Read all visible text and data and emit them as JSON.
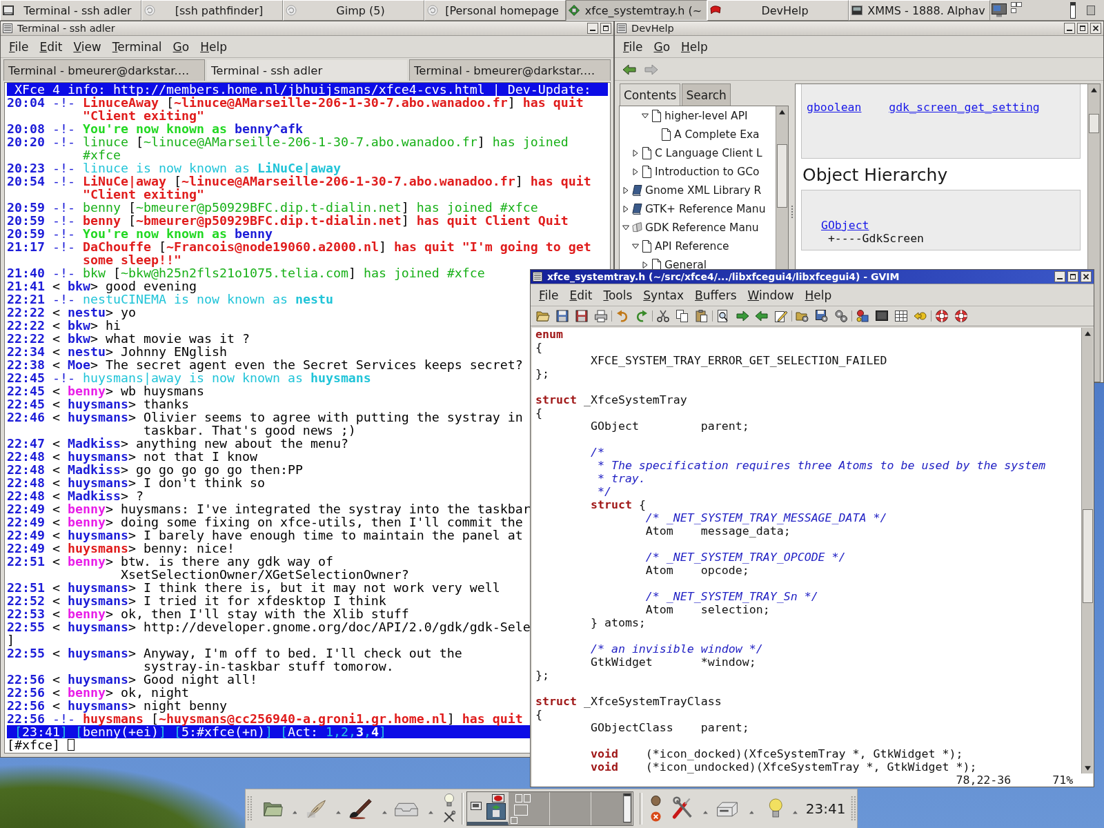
{
  "taskbar": {
    "tasks": [
      {
        "label": "Terminal - ssh adler",
        "selected": false
      },
      {
        "label": "[ssh pathfinder]",
        "selected": false
      },
      {
        "label": "Gimp (5)",
        "selected": false
      },
      {
        "label": "[Personal homepage",
        "selected": false
      },
      {
        "label": "xfce_systemtray.h (~",
        "selected": true
      },
      {
        "label": "DevHelp",
        "selected": false
      },
      {
        "label": "XMMS - 1888. Alphav",
        "selected": false
      }
    ]
  },
  "terminal_window": {
    "title": "Terminal - ssh adler",
    "active": false,
    "menu": [
      "File",
      "Edit",
      "View",
      "Terminal",
      "Go",
      "Help"
    ],
    "tabs": [
      {
        "label": "Terminal - bmeurer@darkstar.…",
        "selected": false
      },
      {
        "label": "Terminal - ssh adler",
        "selected": true
      },
      {
        "label": "Terminal - bmeurer@darkstar.…",
        "selected": false
      }
    ],
    "topic": "XFce 4 info: http://members.home.nl/jbhuijsmans/xfce4-cvs.html | Dev-Update:",
    "lines": [
      {
        "kind": "event",
        "time": "20:04",
        "marker": "-!-",
        "segments": [
          {
            "text": "LinuceAway",
            "color": "#e01c1c",
            "bold": true
          },
          {
            "text": " [",
            "color": "#000000",
            "bold": false
          },
          {
            "text": "~linuce@AMarseille-206-1-30-7.abo.wanadoo.fr",
            "color": "#e01c1c",
            "bold": true
          },
          {
            "text": "] ",
            "color": "#000000",
            "bold": false
          },
          {
            "text": "has quit",
            "color": "#e01c1c",
            "bold": true
          }
        ]
      },
      {
        "kind": "wrap",
        "segments": [
          {
            "text": "\"Client exiting\"",
            "color": "#e01c1c",
            "bold": true
          }
        ]
      },
      {
        "kind": "event",
        "time": "20:08",
        "marker": "-!-",
        "segments": [
          {
            "text": "You're now known as ",
            "color": "#22d822",
            "bold": true
          },
          {
            "text": "benny^afk",
            "color": "#1c1cd8",
            "bold": true
          }
        ]
      },
      {
        "kind": "event",
        "time": "20:20",
        "marker": "-!-",
        "segments": [
          {
            "text": "linuce",
            "color": "#18b018",
            "bold": false
          },
          {
            "text": " [",
            "color": "#000000",
            "bold": false
          },
          {
            "text": "~linuce@AMarseille-206-1-30-7.abo.wanadoo.fr",
            "color": "#18b018",
            "bold": false
          },
          {
            "text": "] ",
            "color": "#000000",
            "bold": false
          },
          {
            "text": "has joined",
            "color": "#18b018",
            "bold": false
          }
        ]
      },
      {
        "kind": "wrap",
        "segments": [
          {
            "text": "#xfce",
            "color": "#18b018",
            "bold": false
          }
        ]
      },
      {
        "kind": "event",
        "time": "20:23",
        "marker": "-!-",
        "segments": [
          {
            "text": "linuce is now known as ",
            "color": "#20c4d8",
            "bold": false
          },
          {
            "text": "LiNuCe|away",
            "color": "#20c4d8",
            "bold": true
          }
        ]
      },
      {
        "kind": "event",
        "time": "20:54",
        "marker": "-!-",
        "segments": [
          {
            "text": "LiNuCe|away",
            "color": "#e01c1c",
            "bold": true
          },
          {
            "text": " [",
            "color": "#000000",
            "bold": false
          },
          {
            "text": "~linuce@AMarseille-206-1-30-7.abo.wanadoo.fr",
            "color": "#e01c1c",
            "bold": true
          },
          {
            "text": "] ",
            "color": "#000000",
            "bold": false
          },
          {
            "text": "has quit",
            "color": "#e01c1c",
            "bold": true
          }
        ]
      },
      {
        "kind": "wrap",
        "segments": [
          {
            "text": "\"Client exiting\"",
            "color": "#e01c1c",
            "bold": true
          }
        ]
      },
      {
        "kind": "event",
        "time": "20:59",
        "marker": "-!-",
        "segments": [
          {
            "text": "benny",
            "color": "#18b018",
            "bold": false
          },
          {
            "text": " [",
            "color": "#000000",
            "bold": false
          },
          {
            "text": "~bmeurer@p50929BFC.dip.t-dialin.net",
            "color": "#18b018",
            "bold": false
          },
          {
            "text": "] ",
            "color": "#000000",
            "bold": false
          },
          {
            "text": "has joined #xfce",
            "color": "#18b018",
            "bold": false
          }
        ]
      },
      {
        "kind": "event",
        "time": "20:59",
        "marker": "-!-",
        "segments": [
          {
            "text": "benny",
            "color": "#e01c1c",
            "bold": true
          },
          {
            "text": " [",
            "color": "#000000",
            "bold": false
          },
          {
            "text": "~bmeurer@p50929BFC.dip.t-dialin.net",
            "color": "#e01c1c",
            "bold": true
          },
          {
            "text": "] ",
            "color": "#000000",
            "bold": false
          },
          {
            "text": "has quit Client Quit",
            "color": "#e01c1c",
            "bold": true
          }
        ]
      },
      {
        "kind": "event",
        "time": "20:59",
        "marker": "-!-",
        "segments": [
          {
            "text": "You're now known as ",
            "color": "#22d822",
            "bold": true
          },
          {
            "text": "benny",
            "color": "#1c1cd8",
            "bold": true
          }
        ]
      },
      {
        "kind": "event",
        "time": "21:17",
        "marker": "-!-",
        "segments": [
          {
            "text": "DaChouffe",
            "color": "#e01c1c",
            "bold": true
          },
          {
            "text": " [",
            "color": "#000000",
            "bold": false
          },
          {
            "text": "~Francois@node19060.a2000.nl",
            "color": "#e01c1c",
            "bold": true
          },
          {
            "text": "] ",
            "color": "#000000",
            "bold": false
          },
          {
            "text": "has quit \"I'm going to get",
            "color": "#e01c1c",
            "bold": true
          }
        ]
      },
      {
        "kind": "wrap",
        "segments": [
          {
            "text": "some sleep!!\"",
            "color": "#e01c1c",
            "bold": true
          }
        ]
      },
      {
        "kind": "event",
        "time": "21:40",
        "marker": "-!-",
        "segments": [
          {
            "text": "bkw",
            "color": "#18b018",
            "bold": false
          },
          {
            "text": " [",
            "color": "#000000",
            "bold": false
          },
          {
            "text": "~bkw@h25n2fls21o1075.telia.com",
            "color": "#18b018",
            "bold": false
          },
          {
            "text": "] ",
            "color": "#000000",
            "bold": false
          },
          {
            "text": "has joined #xfce",
            "color": "#18b018",
            "bold": false
          }
        ]
      },
      {
        "kind": "msg",
        "time": "21:41",
        "open": "<",
        "nick": "bkw",
        "close": ">",
        "color": "#1c1cd8",
        "text": "good evening"
      },
      {
        "kind": "event",
        "time": "22:21",
        "marker": "-!-",
        "segments": [
          {
            "text": "nestuCINEMA is now known as ",
            "color": "#20c4d8",
            "bold": false
          },
          {
            "text": "nestu",
            "color": "#20c4d8",
            "bold": true
          }
        ]
      },
      {
        "kind": "msg",
        "time": "22:22",
        "open": "<",
        "nick": "nestu",
        "close": ">",
        "color": "#1c1cd8",
        "text": "yo"
      },
      {
        "kind": "msg",
        "time": "22:22",
        "open": "<",
        "nick": "bkw",
        "close": ">",
        "color": "#1c1cd8",
        "text": "hi"
      },
      {
        "kind": "msg",
        "time": "22:22",
        "open": "<",
        "nick": "bkw",
        "close": ">",
        "color": "#1c1cd8",
        "text": "what movie was it ?"
      },
      {
        "kind": "msg",
        "time": "22:34",
        "open": "<",
        "nick": "nestu",
        "close": ">",
        "color": "#1c1cd8",
        "text": "Johnny ENglish"
      },
      {
        "kind": "msg",
        "time": "22:38",
        "open": "<",
        "nick": "Moe",
        "close": ">",
        "color": "#1c1cd8",
        "text": "The secret agent even the Secret Services keeps secret?"
      },
      {
        "kind": "event",
        "time": "22:45",
        "marker": "-!-",
        "segments": [
          {
            "text": "huysmans|away is now known as ",
            "color": "#20c4d8",
            "bold": false
          },
          {
            "text": "huysmans",
            "color": "#20c4d8",
            "bold": true
          }
        ]
      },
      {
        "kind": "msg",
        "time": "22:45",
        "open": "<",
        "nick": "benny",
        "close": ">",
        "color": "#e81ce8",
        "text": "wb huysmans"
      },
      {
        "kind": "msg",
        "time": "22:45",
        "open": "<",
        "nick": "huysmans",
        "close": ">",
        "color": "#1c1cd8",
        "text": "thanks"
      },
      {
        "kind": "msg",
        "time": "22:46",
        "open": "<",
        "nick": "huysmans",
        "close": ">",
        "color": "#1c1cd8",
        "text": "Olivier seems to agree with putting the systray in"
      },
      {
        "kind": "wrap",
        "segments": [
          {
            "text": "taskbar. That's good news ;)",
            "color": "#000000",
            "bold": false
          }
        ]
      },
      {
        "kind": "msg",
        "time": "22:47",
        "open": "<",
        "nick": "Madkiss",
        "close": ">",
        "color": "#1c1cd8",
        "text": "anything new about the menu?"
      },
      {
        "kind": "msg",
        "time": "22:48",
        "open": "<",
        "nick": "huysmans",
        "close": ">",
        "color": "#1c1cd8",
        "text": "not that I know"
      },
      {
        "kind": "msg",
        "time": "22:48",
        "open": "<",
        "nick": "Madkiss",
        "close": ">",
        "color": "#1c1cd8",
        "text": "go go go go go then:PP"
      },
      {
        "kind": "msg",
        "time": "22:48",
        "open": "<",
        "nick": "huysmans",
        "close": ">",
        "color": "#1c1cd8",
        "text": "I don't think so"
      },
      {
        "kind": "msg",
        "time": "22:48",
        "open": "<",
        "nick": "Madkiss",
        "close": ">",
        "color": "#1c1cd8",
        "text": "?"
      },
      {
        "kind": "msg",
        "time": "22:49",
        "open": "<",
        "nick": "benny",
        "close": ">",
        "color": "#e81ce8",
        "text": "huysmans: I've integrated the systray into the taskbar"
      },
      {
        "kind": "msg",
        "time": "22:49",
        "open": "<",
        "nick": "benny",
        "close": ">",
        "color": "#e81ce8",
        "text": "doing some fixing on xfce-utils, then I'll commit the"
      },
      {
        "kind": "msg",
        "time": "22:49",
        "open": "<",
        "nick": "huysmans",
        "close": ">",
        "color": "#1c1cd8",
        "text": "I barely have enough time to maintain the panel at"
      },
      {
        "kind": "msg",
        "time": "22:49",
        "open": "<",
        "nick": "huysmans",
        "close": ">",
        "color": "#e01c1c",
        "text": "benny: nice!"
      },
      {
        "kind": "msg",
        "time": "22:51",
        "open": "<",
        "nick": "benny",
        "close": ">",
        "color": "#e81ce8",
        "text": "btw. is there any gdk way of"
      },
      {
        "kind": "wrap",
        "segments": [
          {
            "text": "XsetSelectionOwner/XGetSelectionOwner?",
            "color": "#000000",
            "bold": false
          }
        ]
      },
      {
        "kind": "msg",
        "time": "22:51",
        "open": "<",
        "nick": "huysmans",
        "close": ">",
        "color": "#1c1cd8",
        "text": "I think there is, but it may not work very well"
      },
      {
        "kind": "msg",
        "time": "22:52",
        "open": "<",
        "nick": "huysmans",
        "close": ">",
        "color": "#1c1cd8",
        "text": "I tried it for xfdesktop I think"
      },
      {
        "kind": "msg",
        "time": "22:53",
        "open": "<",
        "nick": "benny",
        "close": ">",
        "color": "#e81ce8",
        "text": "ok, then I'll stay with the Xlib stuff"
      },
      {
        "kind": "msg",
        "time": "22:55",
        "open": "<",
        "nick": "huysmans",
        "close": ">",
        "color": "#1c1cd8",
        "text": "http://developer.gnome.org/doc/API/2.0/gdk/gdk-Sele"
      },
      {
        "kind": "plain",
        "text": "]"
      },
      {
        "kind": "msg",
        "time": "22:55",
        "open": "<",
        "nick": "huysmans",
        "close": ">",
        "color": "#1c1cd8",
        "text": "Anyway, I'm off to bed. I'll check out the"
      },
      {
        "kind": "wrap",
        "segments": [
          {
            "text": "systray-in-taskbar stuff tomorow.",
            "color": "#000000",
            "bold": false
          }
        ]
      },
      {
        "kind": "msg",
        "time": "22:56",
        "open": "<",
        "nick": "huysmans",
        "close": ">",
        "color": "#1c1cd8",
        "text": "Good night all!"
      },
      {
        "kind": "msg",
        "time": "22:56",
        "open": "<",
        "nick": "benny",
        "close": ">",
        "color": "#e81ce8",
        "text": "ok, night"
      },
      {
        "kind": "msg",
        "time": "22:56",
        "open": "<",
        "nick": "huysmans",
        "close": ">",
        "color": "#1c1cd8",
        "text": "night benny"
      },
      {
        "kind": "event",
        "time": "22:56",
        "marker": "-!-",
        "segments": [
          {
            "text": "huysmans",
            "color": "#e01c1c",
            "bold": true
          },
          {
            "text": " [",
            "color": "#000000",
            "bold": false
          },
          {
            "text": "~huysmans@cc256940-a.groni1.gr.home.nl",
            "color": "#e01c1c",
            "bold": true
          },
          {
            "text": "] ",
            "color": "#000000",
            "bold": false
          },
          {
            "text": "has quit",
            "color": "#e01c1c",
            "bold": true
          }
        ]
      }
    ],
    "status_bar": {
      "segments": [
        {
          "text": "[",
          "kind": "accent",
          "bold": false
        },
        {
          "text": "23:41",
          "kind": "plain",
          "bold": false
        },
        {
          "text": "] [",
          "kind": "accent",
          "bold": false
        },
        {
          "text": "benny(+ei)",
          "kind": "plain",
          "bold": false
        },
        {
          "text": "] [",
          "kind": "accent",
          "bold": false
        },
        {
          "text": "5:#xfce(+n)",
          "kind": "plain",
          "bold": false
        },
        {
          "text": "] [",
          "kind": "accent",
          "bold": false
        },
        {
          "text": "Act: ",
          "kind": "plain",
          "bold": false
        },
        {
          "text": "1,2,",
          "kind": "accent",
          "bold": false
        },
        {
          "text": "3",
          "kind": "plain",
          "bold": true
        },
        {
          "text": ",",
          "kind": "accent",
          "bold": false
        },
        {
          "text": "4",
          "kind": "plain",
          "bold": true
        },
        {
          "text": "]",
          "kind": "accent",
          "bold": false
        }
      ]
    },
    "input": {
      "prompt": "[#xfce]"
    }
  },
  "devhelp_window": {
    "title": "DevHelp",
    "active": false,
    "menu": [
      "File",
      "Go",
      "Help"
    ],
    "back_button": {
      "disabled": false
    },
    "forward_button": {
      "disabled": true
    },
    "sidebar_tabs": [
      {
        "label": "Contents",
        "selected": true
      },
      {
        "label": "Search",
        "selected": false
      }
    ],
    "tree": [
      {
        "children": [
          {
            "children": [
              {
                "label": "higher-level API",
                "kind": "page",
                "expanded": true,
                "children": [
                  {
                    "label": "A Complete Exa",
                    "kind": "page"
                  }
                ]
              }
            ]
          },
          {
            "label": "C Language Client L",
            "kind": "page",
            "expanded": false
          },
          {
            "label": "Introduction to GCo",
            "kind": "page",
            "expanded": false
          }
        ]
      },
      {
        "label": "Gnome XML Library R",
        "kind": "book",
        "expanded": false
      },
      {
        "label": "GTK+ Reference Manu",
        "kind": "book",
        "expanded": false
      },
      {
        "label": "GDK Reference Manu",
        "kind": "open-book",
        "expanded": true,
        "children": [
          {
            "label": "API Reference",
            "kind": "page",
            "expanded": true,
            "children": [
              {
                "label": "General",
                "kind": "page",
                "expanded": false
              }
            ]
          }
        ]
      }
    ],
    "content": {
      "signature": {
        "type_link": "gboolean",
        "function_link": "gdk_screen_get_setting"
      },
      "hierarchy_heading": "Object Hierarchy",
      "hierarchy": {
        "parent_link": "GObject",
        "child": "+----GdkScreen"
      }
    }
  },
  "gvim_window": {
    "title": "xfce_systemtray.h (~/src/xfce4/.../libxfcegui4/libxfcegui4) - GVIM",
    "active": true,
    "menu": [
      "File",
      "Edit",
      "Tools",
      "Syntax",
      "Buffers",
      "Window",
      "Help"
    ],
    "lines": [
      {
        "kind": "code",
        "segments": [
          {
            "text": "enum",
            "kind": "keyword"
          }
        ]
      },
      {
        "kind": "code",
        "segments": [
          {
            "text": "{",
            "kind": "plain"
          }
        ]
      },
      {
        "kind": "code",
        "segments": [
          {
            "text": "        XFCE_SYSTEM_TRAY_ERROR_GET_SELECTION_FAILED",
            "kind": "plain"
          }
        ]
      },
      {
        "kind": "code",
        "segments": [
          {
            "text": "};",
            "kind": "plain"
          }
        ]
      },
      {
        "kind": "blank"
      },
      {
        "kind": "code",
        "segments": [
          {
            "text": "struct",
            "kind": "keyword"
          },
          {
            "text": " _XfceSystemTray",
            "kind": "plain"
          }
        ]
      },
      {
        "kind": "code",
        "segments": [
          {
            "text": "{",
            "kind": "plain"
          }
        ]
      },
      {
        "kind": "code",
        "segments": [
          {
            "text": "        GObject         parent;",
            "kind": "plain"
          }
        ]
      },
      {
        "kind": "blank"
      },
      {
        "kind": "code",
        "segments": [
          {
            "text": "        /*",
            "kind": "comment"
          }
        ]
      },
      {
        "kind": "code",
        "segments": [
          {
            "text": "         * The specification requires three Atoms to be used by the system",
            "kind": "comment"
          }
        ]
      },
      {
        "kind": "code",
        "segments": [
          {
            "text": "         * tray.",
            "kind": "comment"
          }
        ]
      },
      {
        "kind": "code",
        "segments": [
          {
            "text": "         */",
            "kind": "comment"
          }
        ]
      },
      {
        "kind": "code",
        "segments": [
          {
            "text": "        struct",
            "kind": "keyword"
          },
          {
            "text": " {",
            "kind": "plain"
          }
        ]
      },
      {
        "kind": "code",
        "segments": [
          {
            "text": "                /* _NET_SYSTEM_TRAY_MESSAGE_DATA */",
            "kind": "comment"
          }
        ]
      },
      {
        "kind": "code",
        "segments": [
          {
            "text": "                Atom    message_data;",
            "kind": "plain"
          }
        ]
      },
      {
        "kind": "blank"
      },
      {
        "kind": "code",
        "segments": [
          {
            "text": "                /* _NET_SYSTEM_TRAY_OPCODE */",
            "kind": "comment"
          }
        ]
      },
      {
        "kind": "code",
        "segments": [
          {
            "text": "                Atom    opcode;",
            "kind": "plain"
          }
        ]
      },
      {
        "kind": "blank"
      },
      {
        "kind": "code",
        "segments": [
          {
            "text": "                /* _NET_SYSTEM_TRAY_Sn */",
            "kind": "comment"
          }
        ]
      },
      {
        "kind": "code",
        "segments": [
          {
            "text": "                Atom    selection;",
            "kind": "plain"
          }
        ]
      },
      {
        "kind": "code",
        "segments": [
          {
            "text": "        } atoms;",
            "kind": "plain"
          }
        ]
      },
      {
        "kind": "blank"
      },
      {
        "kind": "code",
        "segments": [
          {
            "text": "        /* an invisible window */",
            "kind": "comment"
          }
        ]
      },
      {
        "kind": "code",
        "segments": [
          {
            "text": "        GtkWidget       *window;",
            "kind": "plain"
          }
        ]
      },
      {
        "kind": "code",
        "segments": [
          {
            "text": "};",
            "kind": "plain"
          }
        ]
      },
      {
        "kind": "blank"
      },
      {
        "kind": "code",
        "segments": [
          {
            "text": "struct",
            "kind": "keyword"
          },
          {
            "text": " _XfceSystemTrayClass",
            "kind": "plain"
          }
        ]
      },
      {
        "kind": "code",
        "segments": [
          {
            "text": "{",
            "kind": "plain"
          }
        ]
      },
      {
        "kind": "code",
        "segments": [
          {
            "text": "        GObjectClass    parent;",
            "kind": "plain"
          }
        ]
      },
      {
        "kind": "blank"
      },
      {
        "kind": "code",
        "segments": [
          {
            "text": "        void",
            "kind": "keyword"
          },
          {
            "text": "    (*icon_docked)(XfceSystemTray *, GtkWidget *);",
            "kind": "plain"
          }
        ]
      },
      {
        "kind": "code",
        "segments": [
          {
            "text": "        void",
            "kind": "keyword"
          },
          {
            "text": "    (*icon_undocked)(XfceSystemTray *, GtkWidget *);",
            "kind": "plain"
          }
        ]
      }
    ],
    "ruler": {
      "position": "78,22-36",
      "percent": "71%"
    }
  },
  "panel": {
    "workspaces": [
      {
        "selected": true
      },
      {
        "selected": false
      },
      {
        "selected": false
      },
      {
        "selected": false
      }
    ],
    "clock": "23:41"
  }
}
